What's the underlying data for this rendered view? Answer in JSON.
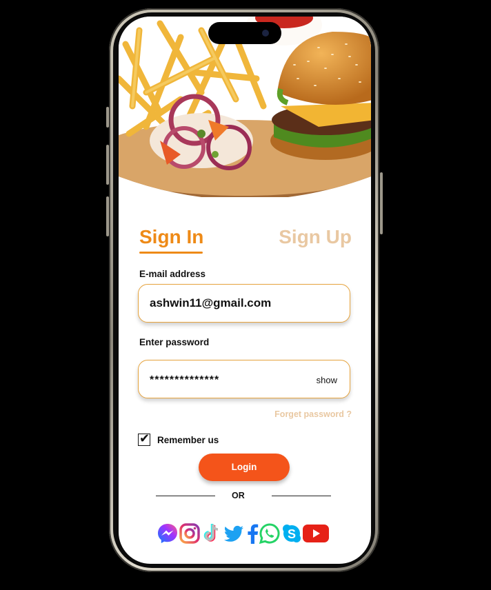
{
  "tabs": {
    "signin": "Sign In",
    "signup": "Sign Up"
  },
  "form": {
    "email_label": "E-mail address",
    "email_value": "ashwin11@gmail.com",
    "password_label": "Enter password",
    "password_value": "**************",
    "show_label": "show",
    "forget_label": "Forget password ?",
    "remember_label": "Remember us",
    "remember_checked": true,
    "login_label": "Login",
    "or_label": "OR"
  },
  "social_icons": [
    "messenger-icon",
    "instagram-icon",
    "tiktok-icon",
    "twitter-icon",
    "facebook-icon",
    "whatsapp-icon",
    "skype-icon",
    "youtube-icon"
  ],
  "colors": {
    "accent": "#ee8a17",
    "accent_light": "#e9c8a2",
    "login": "#f4541a",
    "field_border": "#e6a33d"
  }
}
